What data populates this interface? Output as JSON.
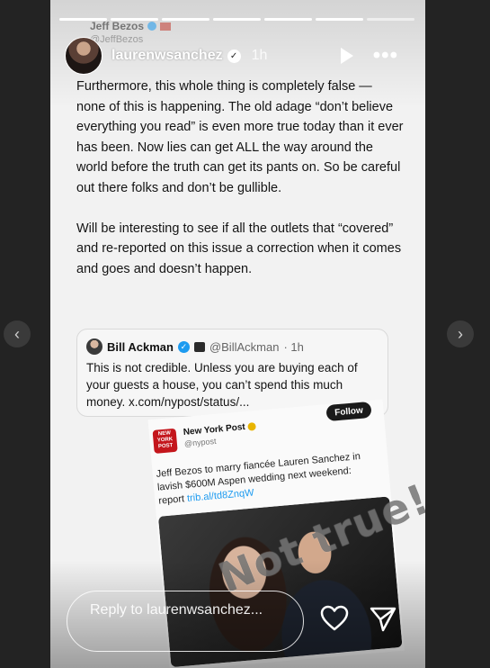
{
  "story": {
    "username": "laurenwsanchez",
    "time": "1h",
    "progress_total": 7,
    "progress_current": 6
  },
  "ghost_header": {
    "name": "Jeff Bezos",
    "handle": "@JeffBezos"
  },
  "tweet": {
    "paragraph1": "Furthermore, this whole thing is completely false — none of this is happening. The old adage “don’t believe everything you read” is even more true today than it ever has been. Now lies can get ALL the way around the world before the truth can get its pants on. So be careful out there folks and don’t be gullible.",
    "paragraph2": "Will be interesting to see if all the outlets that “covered” and re-reported on this issue a correction when it comes and goes and doesn’t happen."
  },
  "quote": {
    "name": "Bill Ackman",
    "handle": "@BillAckman",
    "time": "· 1h",
    "text": "This is not credible. Unless you are buying each of your guests a house, you can’t spend this much money. x.com/nypost/status/..."
  },
  "nypost": {
    "follow_label": "Follow",
    "name": "New York Post",
    "handle": "@nypost",
    "logo_text": "NEW YORK POST",
    "text": "Jeff Bezos to marry fiancée Lauren Sanchez in lavish $600M Aspen wedding next weekend: report",
    "link": "trib.al/td8ZnqW"
  },
  "overlay_text": "Not true!",
  "reply": {
    "placeholder": "Reply to laurenwsanchez..."
  },
  "icons": {
    "prev": "chevron-left-icon",
    "next": "chevron-right-icon",
    "play": "play-icon",
    "more": "more-icon",
    "heart": "heart-icon",
    "send": "send-icon"
  },
  "colors": {
    "verified": "#1d9bf0",
    "nypost_red": "#c4161c"
  }
}
